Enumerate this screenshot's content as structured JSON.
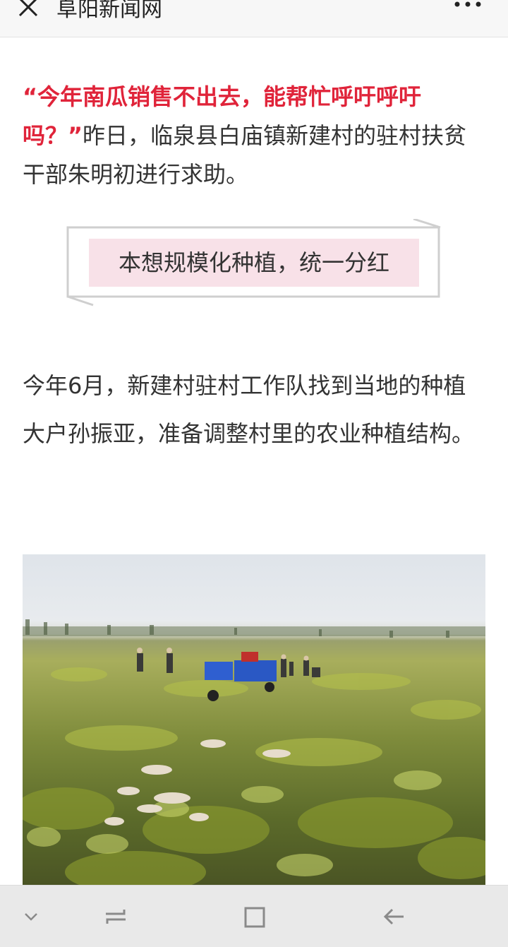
{
  "topbar": {
    "title": "阜阳新闻网",
    "close_icon": "close-icon",
    "more_icon": "more-dots-icon"
  },
  "article": {
    "lead_quote": "“今年南瓜销售不出去，能帮忙呼吁呼吁吗？”",
    "lead_text": "昨日，临泉县白庙镇新建村的驻村扶贫干部朱明初进行求助。",
    "subhead": "本想规模化种植，统一分红",
    "paragraph": "今年6月，新建村驻村工作队找到当地的种植大户孙振亚，准备调整村里的农业种植结构。",
    "photo": "pumpkin-field-photo"
  },
  "navbar": {
    "icons": [
      "collapse-chevron-icon",
      "recent-apps-icon",
      "home-square-icon",
      "back-arrow-icon"
    ]
  },
  "colors": {
    "accent_red": "#e0243a",
    "subhead_bg": "#f8e1e8",
    "text": "#333333",
    "topbar_bg": "#f7f7f7",
    "navbar_bg": "#e9e9e9"
  }
}
